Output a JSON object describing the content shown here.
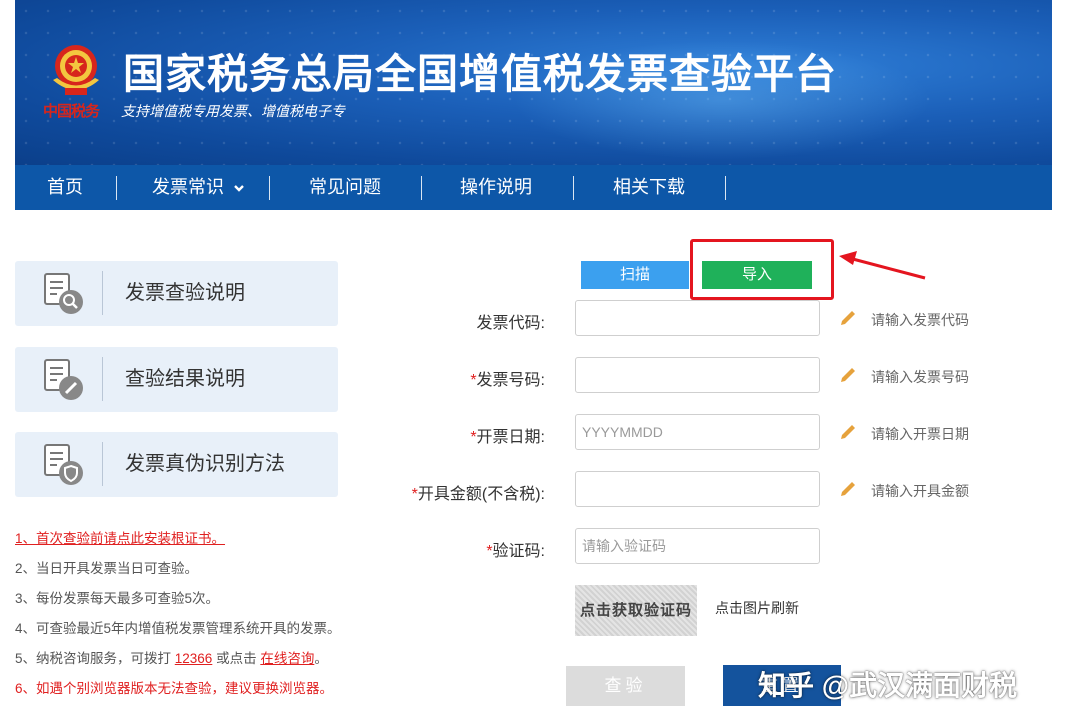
{
  "header": {
    "emblem_text": "中国税务",
    "title": "国家税务总局全国增值税发票查验平台",
    "subtitle": "支持增值税专用发票、增值税电子专"
  },
  "nav": {
    "items": [
      "首页",
      "发票常识",
      "常见问题",
      "操作说明",
      "相关下载"
    ]
  },
  "sidebar": {
    "cards": [
      {
        "label": "发票查验说明",
        "icon": "document-search-icon"
      },
      {
        "label": "查验结果说明",
        "icon": "document-edit-icon"
      },
      {
        "label": "发票真伪识别方法",
        "icon": "document-shield-icon"
      }
    ],
    "notes": {
      "n1": "1、首次查验前请点此安装根证书。",
      "n2": "2、当日开具发票当日可查验。",
      "n3": "3、每份发票每天最多可查验5次。",
      "n4": "4、可查验最近5年内增值税发票管理系统开具的发票。",
      "n5_prefix": "5、纳税咨询服务，可拨打 ",
      "n5_phone": "12366",
      "n5_mid": " 或点击 ",
      "n5_link": "在线咨询",
      "n5_suffix": "。",
      "n6": "6、如遇个别浏览器版本无法查验，建议更换浏览器。"
    }
  },
  "tabs": {
    "scan": "扫描",
    "import": "导入"
  },
  "form": {
    "code": {
      "label": "发票代码:",
      "value": "",
      "hint": "请输入发票代码"
    },
    "number": {
      "star": "*",
      "label": "发票号码:",
      "value": "",
      "hint": "请输入发票号码"
    },
    "date": {
      "star": "*",
      "label": "开票日期:",
      "placeholder": "YYYYMMDD",
      "hint": "请输入开票日期"
    },
    "amount": {
      "star": "*",
      "label": "开具金额(不含税):",
      "value": "",
      "hint": "请输入开具金额"
    },
    "captcha": {
      "star": "*",
      "label": "验证码:",
      "placeholder": "请输入验证码",
      "image_text": "点击获取验证码",
      "refresh": "点击图片刷新"
    }
  },
  "buttons": {
    "check": "查验",
    "reset": "重置"
  },
  "watermark": "知乎 @武汉满面财税",
  "colors": {
    "nav": "#0d57a8",
    "scan_tab": "#3ba0ef",
    "import_tab": "#1fb15a",
    "highlight": "#e4151f",
    "primary_button": "#14539d"
  }
}
